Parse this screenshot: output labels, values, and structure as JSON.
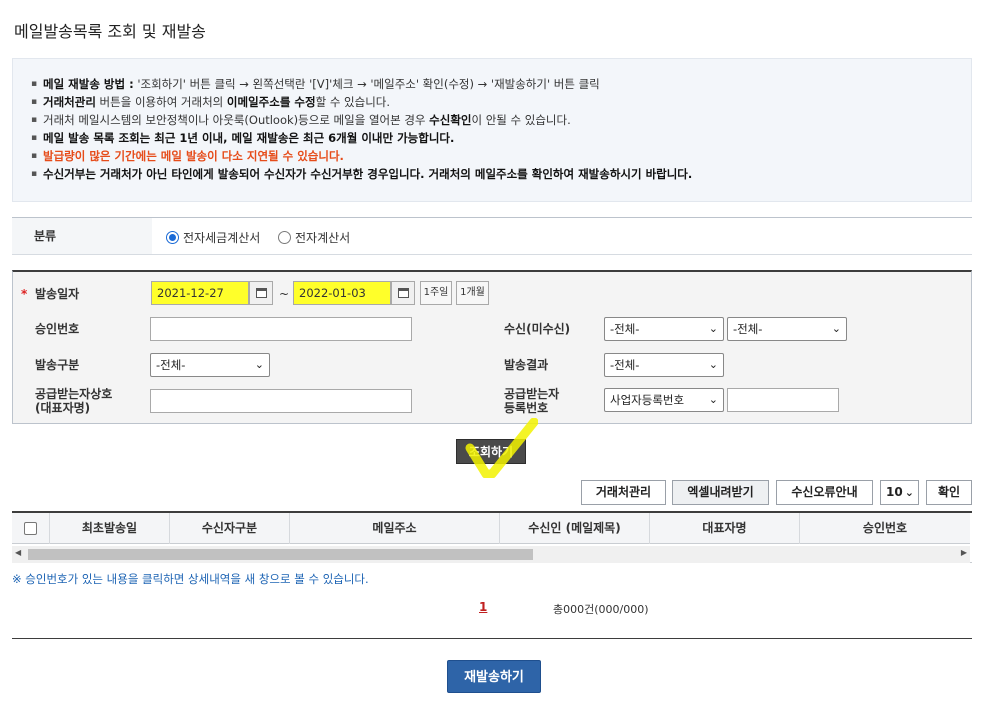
{
  "page": {
    "title": "메일발송목록 조회 및 재발송"
  },
  "guide": {
    "line1_bold": "메일 재발송 방법 :",
    "line1_rest": " '조회하기' 버튼 클릭 → 왼쪽선택란 '[V]'체크 → '메일주소' 확인(수정) → '재발송하기' 버튼 클릭",
    "line2_b1": "거래처관리",
    "line2_t1": " 버튼을 이용하여 거래처의 ",
    "line2_b2": "이메일주소를 수정",
    "line2_t2": "할 수 있습니다.",
    "line3_t1": "거래처 메일시스템의 보안정책이나 아웃룩(Outlook)등으로 메일을 열어본 경우 ",
    "line3_b1": "수신확인",
    "line3_t2": "이 안될 수 있습니다.",
    "line4": "메일 발송 목록 조회는 최근 1년 이내, 메일 재발송은 최근 6개월 이내만 가능합니다.",
    "line5": "발급량이 많은 기간에는 메일 발송이 다소 지연될 수 있습니다.",
    "line6": "수신거부는 거래처가 아닌 타인에게 발송되어 수신자가 수신거부한 경우입니다. 거래처의 메일주소를 확인하여 재발송하시기 바랍니다."
  },
  "category": {
    "label": "분류",
    "options": [
      "전자세금계산서",
      "전자계산서"
    ],
    "selected": 0
  },
  "search": {
    "required_mark": "*",
    "send_date_label": "발송일자",
    "date_from": "2021-12-27",
    "date_to": "2022-01-03",
    "tilde": "~",
    "period_1week": "1주일",
    "period_1month": "1개월",
    "approval_no_label": "승인번호",
    "receipt_label": "수신(미수신)",
    "receipt_select1": "-전체-",
    "receipt_select2": "-전체-",
    "send_type_label": "발송구분",
    "send_type_select": "-전체-",
    "send_result_label": "발송결과",
    "send_result_select": "-전체-",
    "buyer_name_label1": "공급받는자상호",
    "buyer_name_label2": "(대표자명)",
    "buyer_reg_label1": "공급받는자",
    "buyer_reg_label2": "등록번호",
    "buyer_reg_select": "사업자등록번호"
  },
  "buttons": {
    "search": "조회하기",
    "client_mgmt": "거래처관리",
    "excel": "엑셀내려받기",
    "error_guide": "수신오류안내",
    "page_size": "10",
    "confirm": "확인",
    "resend": "재발송하기"
  },
  "table": {
    "columns": [
      "최초발송일",
      "수신자구분",
      "메일주소",
      "수신인 (메일제목)",
      "대표자명",
      "승인번호"
    ]
  },
  "footer": {
    "note": "※ 승인번호가 있는 내용을 클릭하면 상세내역을 새 창으로 볼 수 있습니다.",
    "page": "1",
    "count": "총000건(000/000)"
  },
  "colors": {
    "highlight": "#ffff2a",
    "resend_button": "#2e64a8",
    "warning_text": "#e64c1a",
    "note_text": "#1d64b4"
  }
}
